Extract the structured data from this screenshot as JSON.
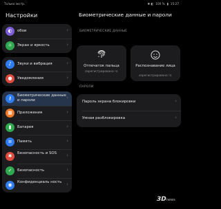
{
  "status_bar": {
    "left": "Только экстр.",
    "right_icons": "✱ ◧",
    "battery": "100 %",
    "time": "15:27"
  },
  "left": {
    "title": "Настройки",
    "groups": [
      {
        "items": [
          {
            "label": "обои",
            "icon": "palette-icon",
            "glyph": "◐",
            "color": "#7a5cd6"
          },
          {
            "label": "Экран и яркость",
            "icon": "display-icon",
            "glyph": "☼",
            "color": "#2fa84f"
          }
        ]
      },
      {
        "items": [
          {
            "label": "Звуки и вибрация",
            "icon": "sound-icon",
            "glyph": "♪",
            "color": "#2f7bf0"
          },
          {
            "label": "Уведомления",
            "icon": "bell-icon",
            "glyph": "●",
            "color": "#e04a3f"
          }
        ]
      },
      {
        "items": [
          {
            "label": "Биометрические данные и пароли",
            "icon": "key-icon",
            "glyph": "⚷",
            "color": "#2f7bf0",
            "active": true
          },
          {
            "label": "Приложения",
            "icon": "apps-icon",
            "glyph": "▦",
            "color": "#f07a25"
          },
          {
            "label": "Батарея",
            "icon": "battery-icon",
            "glyph": "▮",
            "color": "#2fa84f"
          },
          {
            "label": "Память",
            "icon": "storage-icon",
            "glyph": "≡",
            "color": "#2f7bf0"
          },
          {
            "label": "Безопасность и SOS",
            "icon": "sos-icon",
            "glyph": "✱",
            "color": "#e04a3f"
          },
          {
            "label": "Безопасность",
            "icon": "shield-icon",
            "glyph": "✓",
            "color": "#2fa84f"
          },
          {
            "label": "Конфиденциаль ность",
            "icon": "privacy-icon",
            "glyph": "◉",
            "color": "#2f7bf0"
          }
        ]
      }
    ]
  },
  "right": {
    "title": "Биометрические данные и пароли",
    "biometric_header": "БИОМЕТРИЧЕСКИЕ ДАННЫЕ",
    "fingerprint": {
      "title": "Отпечаток пальца",
      "status": "Зарегистрировано: 0."
    },
    "face": {
      "title": "Распознавание лица",
      "status": "Зарегистрировано: 0."
    },
    "passwords_header": "ПАРОЛИ",
    "password_items": [
      "Пароль экрана блокировки",
      "Умная разблокировка"
    ]
  },
  "watermark": {
    "main": "3D",
    "sub": "news"
  }
}
